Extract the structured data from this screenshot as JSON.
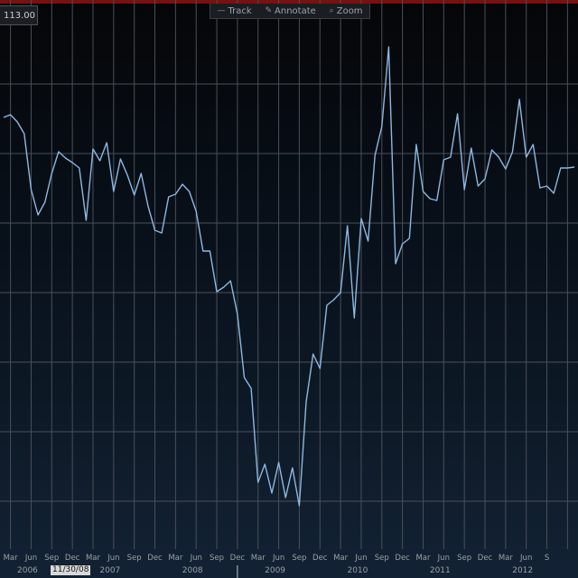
{
  "toolbar": {
    "track_label": "Track",
    "annotate_label": "Annotate",
    "zoom_label": "Zoom"
  },
  "value_box": "113.00",
  "crosshair_date": "11/30/08",
  "colors": {
    "line": "#8fb7e0",
    "grid": "#4a5058",
    "top_bar": "#7a1010"
  },
  "chart_data": {
    "type": "line",
    "title": "",
    "xlabel": "",
    "ylabel": "",
    "x_start": "2006-02",
    "x_end": "2012-06",
    "month_ticks": [
      "Mar",
      "Jun",
      "Sep",
      "Dec",
      "Mar",
      "Jun",
      "Sep",
      "Dec",
      "Mar",
      "Jun",
      "Sep",
      "Dec",
      "Mar",
      "Jun",
      "Sep",
      "Dec",
      "Mar",
      "Jun",
      "Sep",
      "Dec",
      "Mar",
      "Jun",
      "Sep",
      "Dec",
      "Mar",
      "Jun",
      "S"
    ],
    "year_ticks": [
      {
        "label": "2006",
        "x": "2006-06"
      },
      {
        "label": "2007",
        "x": "2007-06"
      },
      {
        "label": "2008",
        "x": "2008-06"
      },
      {
        "label": "2009",
        "x": "2009-06"
      },
      {
        "label": "2010",
        "x": "2010-06"
      },
      {
        "label": "2011",
        "x": "2011-06"
      },
      {
        "label": "2012",
        "x": "2012-06"
      }
    ],
    "ylim": [
      0,
      640
    ],
    "y_grid": [
      93,
      170,
      247,
      324,
      401,
      478,
      555
    ],
    "series": [
      {
        "values": [
          [
            "2006-02",
            130
          ],
          [
            "2006-03",
            127
          ],
          [
            "2006-04",
            135
          ],
          [
            "2006-05",
            148
          ],
          [
            "2006-06",
            210
          ],
          [
            "2006-07",
            238
          ],
          [
            "2006-08",
            224
          ],
          [
            "2006-09",
            192
          ],
          [
            "2006-10",
            168
          ],
          [
            "2006-11",
            175
          ],
          [
            "2006-12",
            180
          ],
          [
            "2007-01",
            186
          ],
          [
            "2007-02",
            244
          ],
          [
            "2007-03",
            165
          ],
          [
            "2007-04",
            178
          ],
          [
            "2007-05",
            158
          ],
          [
            "2007-06",
            212
          ],
          [
            "2007-07",
            176
          ],
          [
            "2007-08",
            194
          ],
          [
            "2007-09",
            216
          ],
          [
            "2007-10",
            192
          ],
          [
            "2007-11",
            228
          ],
          [
            "2007-12",
            255
          ],
          [
            "2008-01",
            258
          ],
          [
            "2008-02",
            218
          ],
          [
            "2008-03",
            215
          ],
          [
            "2008-04",
            204
          ],
          [
            "2008-05",
            212
          ],
          [
            "2008-06",
            234
          ],
          [
            "2008-07",
            278
          ],
          [
            "2008-08",
            278
          ],
          [
            "2008-09",
            323
          ],
          [
            "2008-10",
            318
          ],
          [
            "2008-11",
            311
          ],
          [
            "2008-12",
            348
          ],
          [
            "2009-01",
            418
          ],
          [
            "2009-02",
            430
          ],
          [
            "2009-03",
            534
          ],
          [
            "2009-04",
            514
          ],
          [
            "2009-05",
            546
          ],
          [
            "2009-06",
            512
          ],
          [
            "2009-07",
            551
          ],
          [
            "2009-08",
            518
          ],
          [
            "2009-09",
            560
          ],
          [
            "2009-10",
            445
          ],
          [
            "2009-11",
            392
          ],
          [
            "2009-12",
            408
          ],
          [
            "2010-01",
            338
          ],
          [
            "2010-02",
            332
          ],
          [
            "2010-03",
            324
          ],
          [
            "2010-04",
            250
          ],
          [
            "2010-05",
            352
          ],
          [
            "2010-06",
            242
          ],
          [
            "2010-07",
            267
          ],
          [
            "2010-08",
            172
          ],
          [
            "2010-09",
            140
          ],
          [
            "2010-10",
            52
          ],
          [
            "2010-11",
            292
          ],
          [
            "2010-12",
            270
          ],
          [
            "2011-01",
            264
          ],
          [
            "2011-02",
            160
          ],
          [
            "2011-03",
            212
          ],
          [
            "2011-04",
            220
          ],
          [
            "2011-05",
            222
          ],
          [
            "2011-06",
            177
          ],
          [
            "2011-07",
            174
          ],
          [
            "2011-08",
            126
          ],
          [
            "2011-09",
            210
          ],
          [
            "2011-10",
            164
          ],
          [
            "2011-11",
            206
          ],
          [
            "2011-12",
            198
          ],
          [
            "2012-01",
            166
          ],
          [
            "2012-02",
            174
          ],
          [
            "2012-03",
            187
          ],
          [
            "2012-04",
            168
          ],
          [
            "2012-05",
            110
          ],
          [
            "2012-06",
            174
          ],
          [
            "2012-07",
            160
          ],
          [
            "2012-08",
            208
          ],
          [
            "2012-09",
            206
          ],
          [
            "2012-10",
            214
          ],
          [
            "2012-11",
            186
          ],
          [
            "2012-12",
            186
          ],
          [
            "2013-01",
            185
          ]
        ]
      }
    ]
  }
}
